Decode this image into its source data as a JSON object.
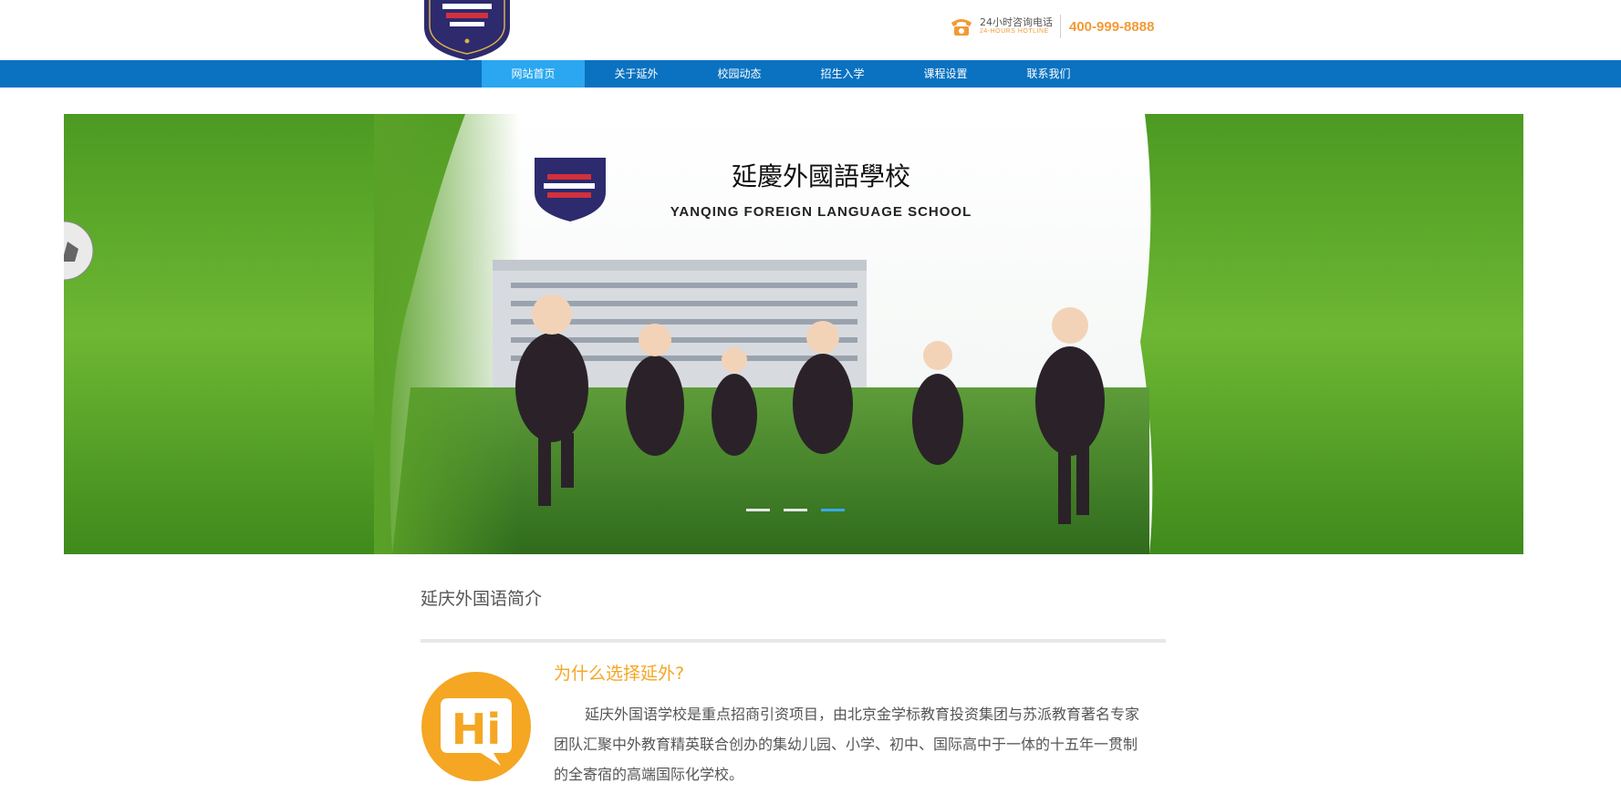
{
  "header": {
    "logo_name": "school-crest-logo",
    "hotline_label_cn": "24小时咨询电话",
    "hotline_label_en": "24-HOURS  HOTLINE",
    "hotline_number": "400-999-8888",
    "accent_color": "#f39a36"
  },
  "nav": {
    "background": "#0a72c0",
    "active_color": "#2aa7f0",
    "items": [
      {
        "label": "网站首页",
        "active": true
      },
      {
        "label": "关于延外",
        "active": false
      },
      {
        "label": "校园动态",
        "active": false
      },
      {
        "label": "招生入学",
        "active": false
      },
      {
        "label": "课程设置",
        "active": false
      },
      {
        "label": "联系我们",
        "active": false
      }
    ]
  },
  "banner": {
    "school_name_cn": "延慶外國語學校",
    "school_name_en": "YANQING FOREIGN  LANGUAGE SCHOOL",
    "slide_count": 3,
    "active_slide": 3
  },
  "intro": {
    "section_title": "延庆外国语简介",
    "badge_text": "Hi",
    "why_title": "为什么选择延外?",
    "body": "延庆外国语学校是重点招商引资项目，由北京金学标教育投资集团与苏派教育著名专家团队汇聚中外教育精英联合创办的集幼儿园、小学、初中、国际高中于一体的十五年一贯制的全寄宿的高端国际化学校。",
    "title_color": "#f5a623"
  }
}
